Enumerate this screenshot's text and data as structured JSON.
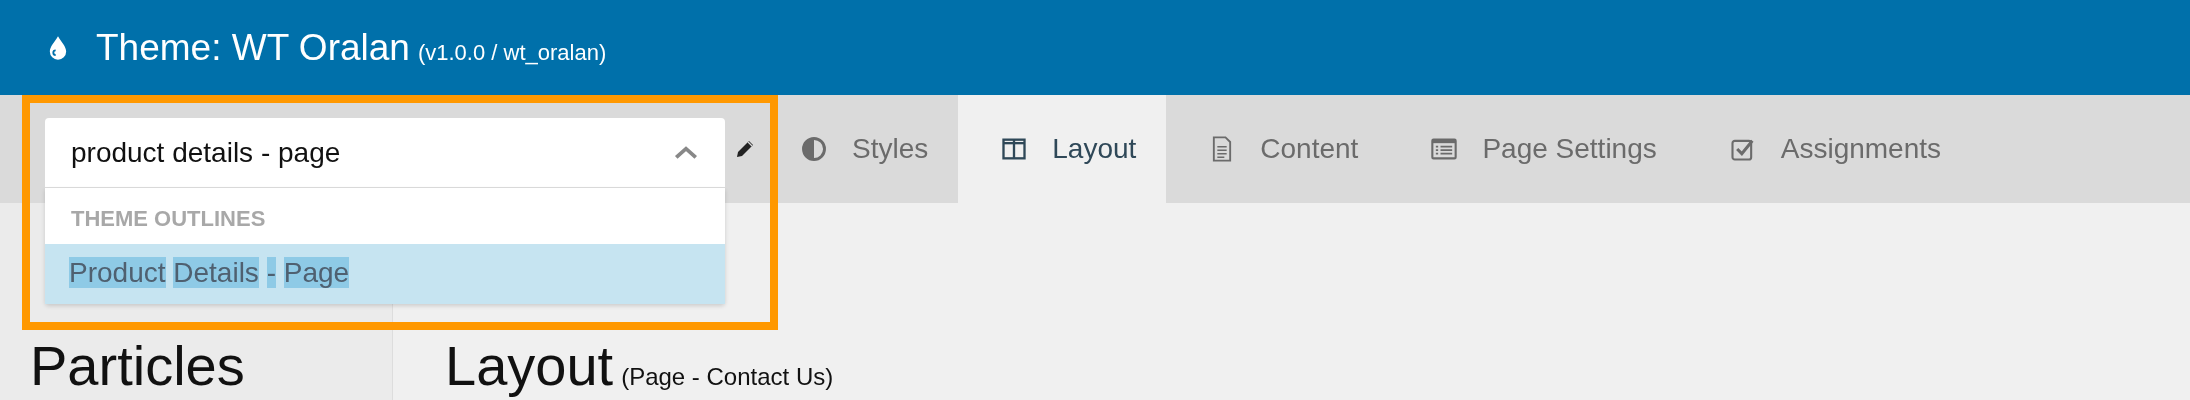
{
  "header": {
    "title": "Theme: WT Oralan",
    "version": "(v1.0.0 / wt_oralan)"
  },
  "outline_select": {
    "value": "product details - page",
    "expanded": true,
    "group_label": "THEME OUTLINES",
    "options": [
      {
        "label": "Product Details - Page",
        "selected": true
      }
    ]
  },
  "tabs": [
    {
      "label": "Styles",
      "selected": false
    },
    {
      "label": "Layout",
      "selected": true
    },
    {
      "label": "Content",
      "selected": false
    },
    {
      "label": "Page Settings",
      "selected": false
    },
    {
      "label": "Assignments",
      "selected": false
    }
  ],
  "sidebar": {
    "title": "Particles"
  },
  "main": {
    "title": "Layout",
    "subtitle": "(Page - Contact Us)"
  }
}
